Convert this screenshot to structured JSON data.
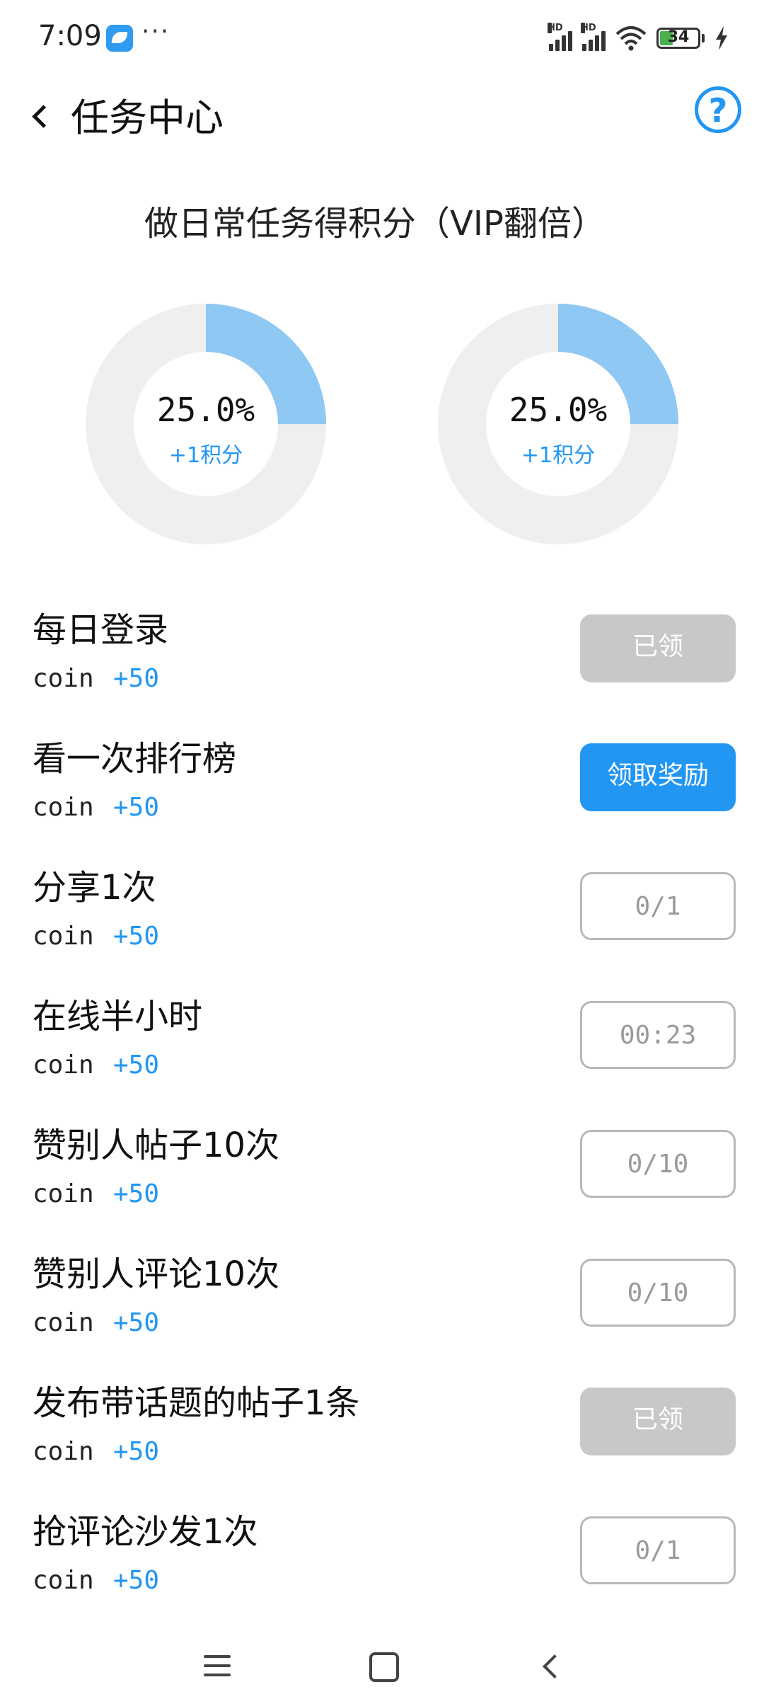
{
  "status_bar": {
    "time": "7:09",
    "more": "···",
    "signal1_label": "HD",
    "signal2_label": "HD",
    "battery": "34",
    "battery_fill_fraction": 0.34,
    "icons": [
      "app-notification-icon",
      "signal-icon",
      "wifi-icon",
      "battery-icon",
      "charging-icon"
    ]
  },
  "header": {
    "title": "任务中心",
    "help_label": "?"
  },
  "subtitle": "做日常任务得积分（VIP翻倍）",
  "progress_rings": [
    {
      "percent_label": "25.0%",
      "fraction": 0.25,
      "sub": "+1积分"
    },
    {
      "percent_label": "25.0%",
      "fraction": 0.25,
      "sub": "+1积分"
    }
  ],
  "colors": {
    "accent": "#2196f3",
    "ring_fill": "#90c8f4",
    "ring_track": "#efefef",
    "done_button": "#c8c8c8"
  },
  "tasks": [
    {
      "name": "每日登录",
      "coin": "coin",
      "reward": "+50",
      "button": "已领",
      "state": "done"
    },
    {
      "name": "看一次排行榜",
      "coin": "coin",
      "reward": "+50",
      "button": "领取奖励",
      "state": "claim"
    },
    {
      "name": "分享1次",
      "coin": "coin",
      "reward": "+50",
      "button": "0/1",
      "state": "progress"
    },
    {
      "name": "在线半小时",
      "coin": "coin",
      "reward": "+50",
      "button": "00:23",
      "state": "progress"
    },
    {
      "name": "赞别人帖子10次",
      "coin": "coin",
      "reward": "+50",
      "button": "0/10",
      "state": "progress"
    },
    {
      "name": "赞别人评论10次",
      "coin": "coin",
      "reward": "+50",
      "button": "0/10",
      "state": "progress"
    },
    {
      "name": "发布带话题的帖子1条",
      "coin": "coin",
      "reward": "+50",
      "button": "已领",
      "state": "done"
    },
    {
      "name": "抢评论沙发1次",
      "coin": "coin",
      "reward": "+50",
      "button": "0/1",
      "state": "progress"
    }
  ],
  "nav_bar": {
    "icons": [
      "menu-icon",
      "home-icon",
      "back-icon"
    ]
  }
}
